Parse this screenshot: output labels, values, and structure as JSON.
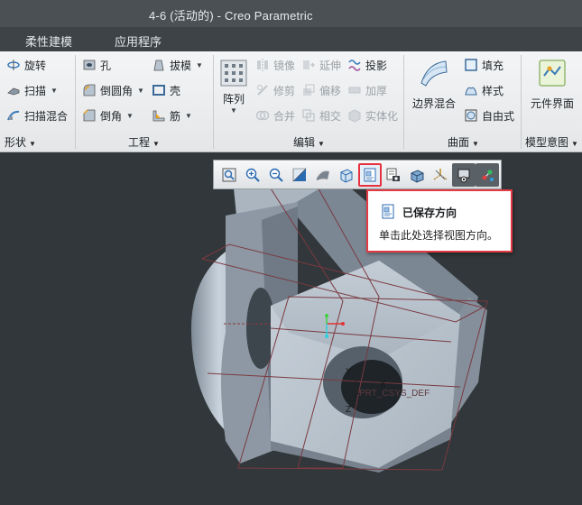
{
  "window": {
    "title": "4-6 (活动的) - Creo Parametric"
  },
  "menubar": {
    "tabs": [
      {
        "label": "柔性建模"
      },
      {
        "label": "应用程序"
      }
    ]
  },
  "ribbon": {
    "shape": {
      "revolve": "旋转",
      "sweep": "扫描",
      "swept_blend": "扫描混合",
      "group": "形状"
    },
    "engineering": {
      "hole": "孔",
      "round": "倒圆角",
      "chamfer": "倒角",
      "draft": "拔模",
      "shell": "壳",
      "rib": "筋",
      "group": "工程"
    },
    "editing": {
      "pattern": "阵列",
      "mirror": "镜像",
      "trim": "修剪",
      "merge": "合并",
      "extend": "延伸",
      "offset": "偏移",
      "intersect": "相交",
      "project": "投影",
      "thicken": "加厚",
      "solidify": "实体化",
      "group": "编辑"
    },
    "surfaces": {
      "boundary_blend": "边界混合",
      "fill": "填充",
      "style": "样式",
      "freestyle": "自由式",
      "group": "曲面"
    },
    "model_intent": {
      "component_interface": "元件界面",
      "group": "模型意图"
    }
  },
  "view_toolbar": {
    "buttons": [
      {
        "icon": "refit-icon"
      },
      {
        "icon": "zoom-in-icon"
      },
      {
        "icon": "zoom-out-icon"
      },
      {
        "icon": "repaint-icon"
      },
      {
        "icon": "display-style-icon"
      },
      {
        "icon": "saved-orientations-icon",
        "selected": true
      },
      {
        "icon": "view-manager-icon"
      },
      {
        "icon": "perspective-icon"
      },
      {
        "icon": "datum-display-icon"
      },
      {
        "icon": "annotation-display-icon"
      },
      {
        "icon": "spin-center-icon"
      }
    ]
  },
  "tooltip": {
    "title": "已保存方向",
    "description": "单击此处选择视图方向。"
  },
  "model_labels": {
    "y_axis": "Y",
    "x_axis": "X",
    "z_axis": "Z",
    "csys_name": "PRT_CSYS_DEF"
  }
}
